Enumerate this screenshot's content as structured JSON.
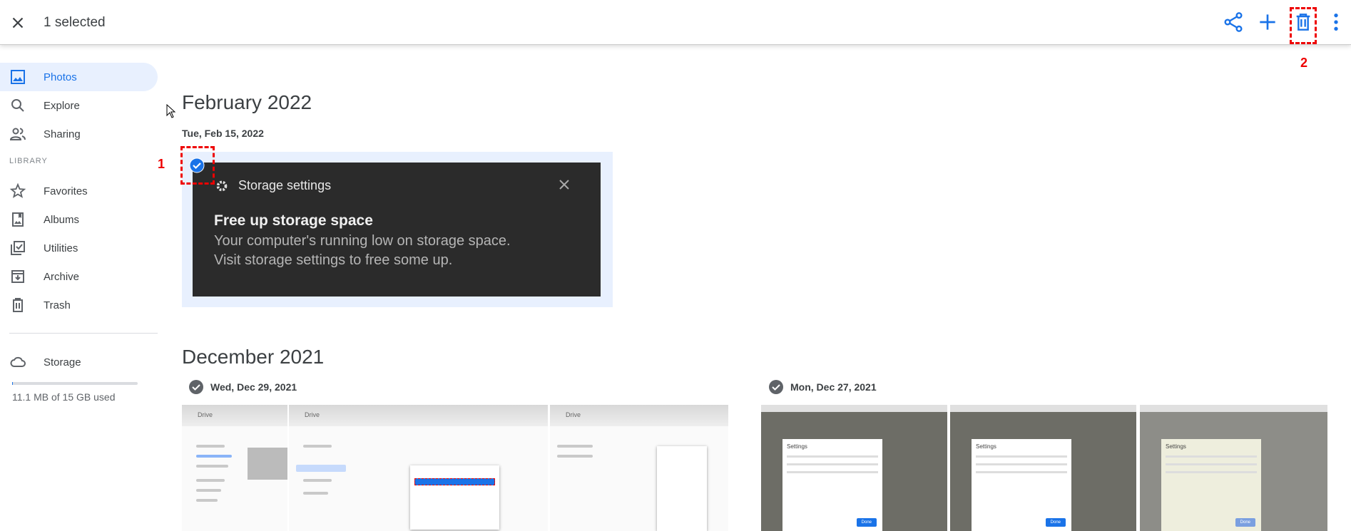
{
  "header": {
    "selection_label": "1 selected",
    "close_icon": "close-icon",
    "actions": [
      "share-icon",
      "add-icon",
      "trash-icon",
      "more-vert-icon"
    ]
  },
  "annotations": {
    "step1": "1",
    "step2": "2",
    "color": "#ee0000"
  },
  "sidebar": {
    "items": [
      {
        "label": "Photos",
        "icon": "photo-icon"
      },
      {
        "label": "Explore",
        "icon": "search-icon"
      },
      {
        "label": "Sharing",
        "icon": "people-icon"
      }
    ],
    "library_heading": "LIBRARY",
    "library_items": [
      {
        "label": "Favorites",
        "icon": "star-icon"
      },
      {
        "label": "Albums",
        "icon": "album-icon"
      },
      {
        "label": "Utilities",
        "icon": "utilities-icon"
      },
      {
        "label": "Archive",
        "icon": "archive-icon"
      },
      {
        "label": "Trash",
        "icon": "trash-icon"
      }
    ],
    "storage": {
      "label": "Storage",
      "usage": "11.1 MB of 15 GB used",
      "used_fraction": 0.0007
    }
  },
  "groups": [
    {
      "month": "February 2022",
      "days": [
        {
          "date": "Tue, Feb 15, 2022",
          "selected": true,
          "photo": {
            "title": "Storage settings",
            "heading": "Free up storage space",
            "line1": "Your computer's running low on storage space.",
            "line2": "Visit storage settings to free some up."
          }
        }
      ]
    },
    {
      "month": "December 2021",
      "days": [
        {
          "date": "Wed, Dec 29, 2021",
          "selected": false,
          "thumbs": [
            "Drive",
            "Drive",
            "Drive"
          ]
        },
        {
          "date": "Mon, Dec 27, 2021",
          "selected": false,
          "thumbs": [
            {
              "title": "Settings",
              "button": "Done"
            },
            {
              "title": "Settings",
              "button": "Done"
            },
            {
              "title": "Settings",
              "button": "Done"
            }
          ]
        }
      ]
    }
  ],
  "colors": {
    "accent": "#1a73e8",
    "selected_bg": "#e8f0fe"
  }
}
